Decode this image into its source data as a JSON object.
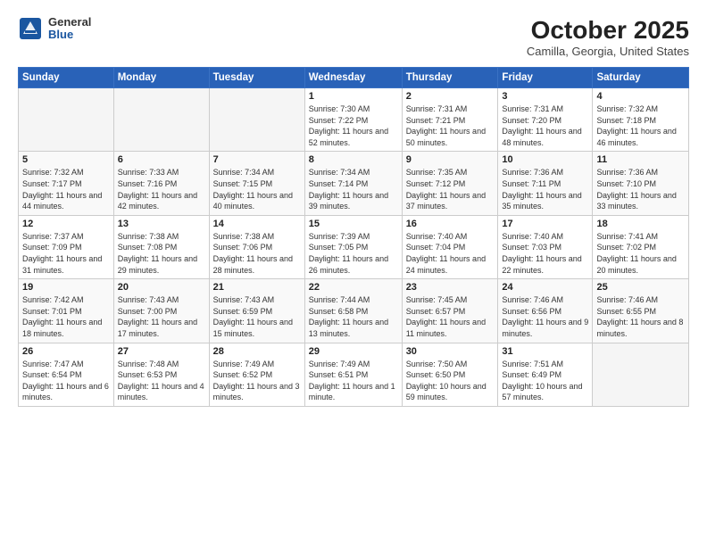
{
  "header": {
    "logo_general": "General",
    "logo_blue": "Blue",
    "title": "October 2025",
    "location": "Camilla, Georgia, United States"
  },
  "days_of_week": [
    "Sunday",
    "Monday",
    "Tuesday",
    "Wednesday",
    "Thursday",
    "Friday",
    "Saturday"
  ],
  "weeks": [
    [
      {
        "day": "",
        "info": ""
      },
      {
        "day": "",
        "info": ""
      },
      {
        "day": "",
        "info": ""
      },
      {
        "day": "1",
        "info": "Sunrise: 7:30 AM\nSunset: 7:22 PM\nDaylight: 11 hours\nand 52 minutes."
      },
      {
        "day": "2",
        "info": "Sunrise: 7:31 AM\nSunset: 7:21 PM\nDaylight: 11 hours\nand 50 minutes."
      },
      {
        "day": "3",
        "info": "Sunrise: 7:31 AM\nSunset: 7:20 PM\nDaylight: 11 hours\nand 48 minutes."
      },
      {
        "day": "4",
        "info": "Sunrise: 7:32 AM\nSunset: 7:18 PM\nDaylight: 11 hours\nand 46 minutes."
      }
    ],
    [
      {
        "day": "5",
        "info": "Sunrise: 7:32 AM\nSunset: 7:17 PM\nDaylight: 11 hours\nand 44 minutes."
      },
      {
        "day": "6",
        "info": "Sunrise: 7:33 AM\nSunset: 7:16 PM\nDaylight: 11 hours\nand 42 minutes."
      },
      {
        "day": "7",
        "info": "Sunrise: 7:34 AM\nSunset: 7:15 PM\nDaylight: 11 hours\nand 40 minutes."
      },
      {
        "day": "8",
        "info": "Sunrise: 7:34 AM\nSunset: 7:14 PM\nDaylight: 11 hours\nand 39 minutes."
      },
      {
        "day": "9",
        "info": "Sunrise: 7:35 AM\nSunset: 7:12 PM\nDaylight: 11 hours\nand 37 minutes."
      },
      {
        "day": "10",
        "info": "Sunrise: 7:36 AM\nSunset: 7:11 PM\nDaylight: 11 hours\nand 35 minutes."
      },
      {
        "day": "11",
        "info": "Sunrise: 7:36 AM\nSunset: 7:10 PM\nDaylight: 11 hours\nand 33 minutes."
      }
    ],
    [
      {
        "day": "12",
        "info": "Sunrise: 7:37 AM\nSunset: 7:09 PM\nDaylight: 11 hours\nand 31 minutes."
      },
      {
        "day": "13",
        "info": "Sunrise: 7:38 AM\nSunset: 7:08 PM\nDaylight: 11 hours\nand 29 minutes."
      },
      {
        "day": "14",
        "info": "Sunrise: 7:38 AM\nSunset: 7:06 PM\nDaylight: 11 hours\nand 28 minutes."
      },
      {
        "day": "15",
        "info": "Sunrise: 7:39 AM\nSunset: 7:05 PM\nDaylight: 11 hours\nand 26 minutes."
      },
      {
        "day": "16",
        "info": "Sunrise: 7:40 AM\nSunset: 7:04 PM\nDaylight: 11 hours\nand 24 minutes."
      },
      {
        "day": "17",
        "info": "Sunrise: 7:40 AM\nSunset: 7:03 PM\nDaylight: 11 hours\nand 22 minutes."
      },
      {
        "day": "18",
        "info": "Sunrise: 7:41 AM\nSunset: 7:02 PM\nDaylight: 11 hours\nand 20 minutes."
      }
    ],
    [
      {
        "day": "19",
        "info": "Sunrise: 7:42 AM\nSunset: 7:01 PM\nDaylight: 11 hours\nand 18 minutes."
      },
      {
        "day": "20",
        "info": "Sunrise: 7:43 AM\nSunset: 7:00 PM\nDaylight: 11 hours\nand 17 minutes."
      },
      {
        "day": "21",
        "info": "Sunrise: 7:43 AM\nSunset: 6:59 PM\nDaylight: 11 hours\nand 15 minutes."
      },
      {
        "day": "22",
        "info": "Sunrise: 7:44 AM\nSunset: 6:58 PM\nDaylight: 11 hours\nand 13 minutes."
      },
      {
        "day": "23",
        "info": "Sunrise: 7:45 AM\nSunset: 6:57 PM\nDaylight: 11 hours\nand 11 minutes."
      },
      {
        "day": "24",
        "info": "Sunrise: 7:46 AM\nSunset: 6:56 PM\nDaylight: 11 hours\nand 9 minutes."
      },
      {
        "day": "25",
        "info": "Sunrise: 7:46 AM\nSunset: 6:55 PM\nDaylight: 11 hours\nand 8 minutes."
      }
    ],
    [
      {
        "day": "26",
        "info": "Sunrise: 7:47 AM\nSunset: 6:54 PM\nDaylight: 11 hours\nand 6 minutes."
      },
      {
        "day": "27",
        "info": "Sunrise: 7:48 AM\nSunset: 6:53 PM\nDaylight: 11 hours\nand 4 minutes."
      },
      {
        "day": "28",
        "info": "Sunrise: 7:49 AM\nSunset: 6:52 PM\nDaylight: 11 hours\nand 3 minutes."
      },
      {
        "day": "29",
        "info": "Sunrise: 7:49 AM\nSunset: 6:51 PM\nDaylight: 11 hours\nand 1 minute."
      },
      {
        "day": "30",
        "info": "Sunrise: 7:50 AM\nSunset: 6:50 PM\nDaylight: 10 hours\nand 59 minutes."
      },
      {
        "day": "31",
        "info": "Sunrise: 7:51 AM\nSunset: 6:49 PM\nDaylight: 10 hours\nand 57 minutes."
      },
      {
        "day": "",
        "info": ""
      }
    ]
  ]
}
